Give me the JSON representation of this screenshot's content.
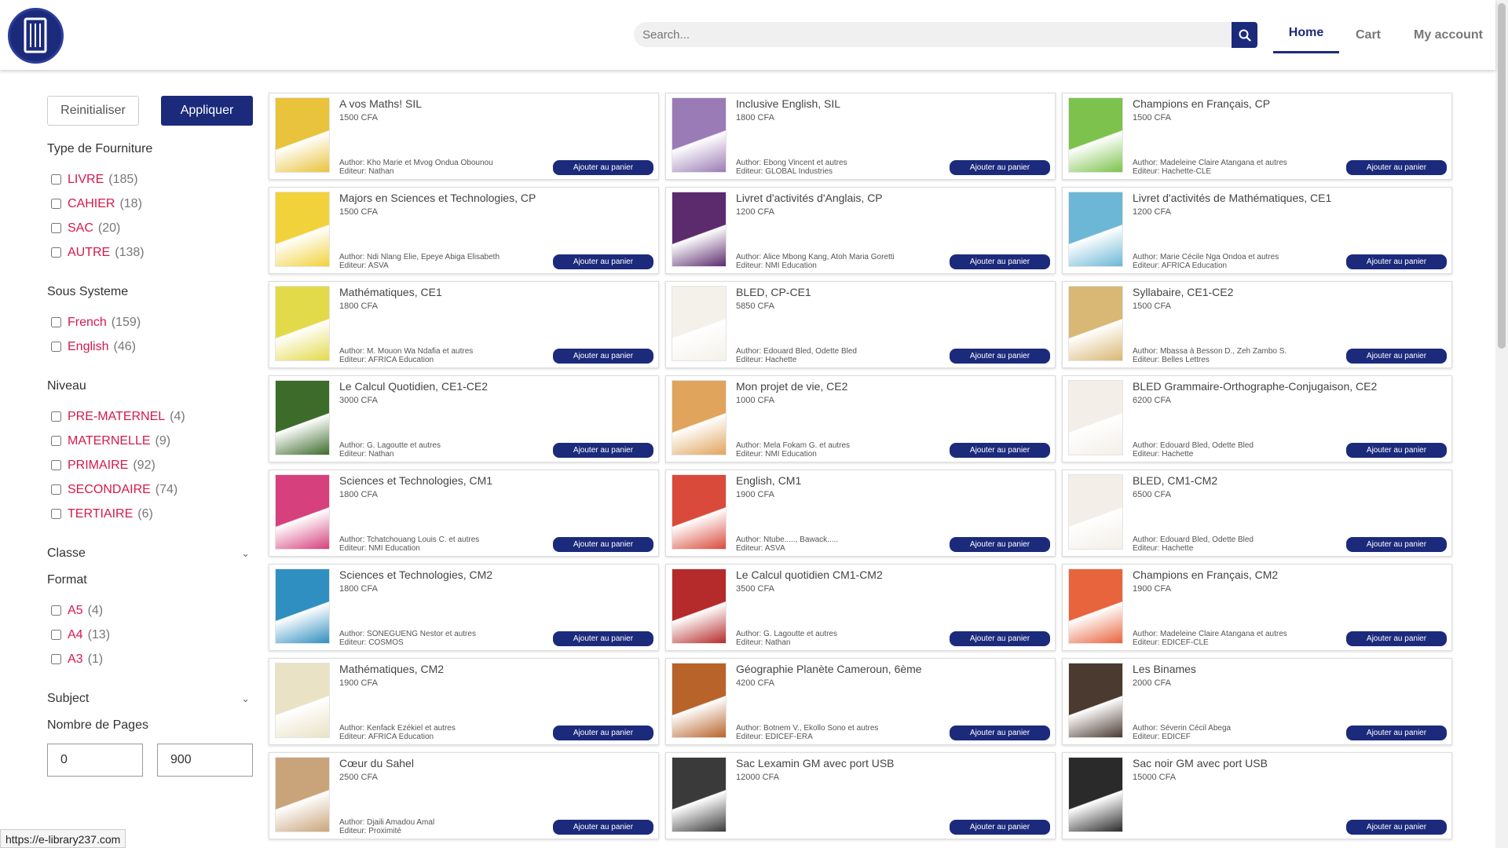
{
  "header": {
    "search_placeholder": "Search...",
    "nav": [
      {
        "label": "Home",
        "active": true
      },
      {
        "label": "Cart",
        "active": false
      },
      {
        "label": "My account",
        "active": false
      }
    ],
    "brand_color": "#1c2a7c"
  },
  "sidebar": {
    "reset_label": "Reinitialiser",
    "apply_label": "Appliquer",
    "type": {
      "title": "Type de Fourniture",
      "items": [
        {
          "label": "LIVRE",
          "count": "(185)"
        },
        {
          "label": "CAHIER",
          "count": "(18)"
        },
        {
          "label": "SAC",
          "count": "(20)"
        },
        {
          "label": "AUTRE",
          "count": "(138)"
        }
      ]
    },
    "sous_systeme": {
      "title": "Sous Systeme",
      "items": [
        {
          "label": "French",
          "count": "(159)"
        },
        {
          "label": "English",
          "count": "(46)"
        }
      ]
    },
    "niveau": {
      "title": "Niveau",
      "items": [
        {
          "label": "PRE-MATERNEL",
          "count": "(4)"
        },
        {
          "label": "MATERNELLE",
          "count": "(9)"
        },
        {
          "label": "PRIMAIRE",
          "count": "(92)"
        },
        {
          "label": "SECONDAIRE",
          "count": "(74)"
        },
        {
          "label": "TERTIAIRE",
          "count": "(6)"
        }
      ]
    },
    "classe_title": "Classe",
    "format": {
      "title": "Format",
      "items": [
        {
          "label": "A5",
          "count": "(4)"
        },
        {
          "label": "A4",
          "count": "(13)"
        },
        {
          "label": "A3",
          "count": "(1)"
        }
      ]
    },
    "subject_title": "Subject",
    "pages": {
      "title": "Nombre de Pages",
      "min": "0",
      "max": "900"
    }
  },
  "add_label": "Ajouter au panier",
  "products": [
    {
      "title": "A vos Maths! SIL",
      "price": "1500 CFA",
      "author": "Author: Kho Marie et Mvog Ondua Obounou",
      "editor": "Editeur: Nathan",
      "cover": "#e9c33b"
    },
    {
      "title": "Inclusive English, SIL",
      "price": "1800 CFA",
      "author": "Author: Ebong Vincent et autres",
      "editor": "Editeur: GLOBAL Industries",
      "cover": "#9a7bb5"
    },
    {
      "title": "Champions en Français, CP",
      "price": "1500 CFA",
      "author": "Author: Madeleine Claire Atangana et autres",
      "editor": "Editeur: Hachette-CLE",
      "cover": "#7cc24c"
    },
    {
      "title": "Majors en Sciences et Technologies, CP",
      "price": "1500 CFA",
      "author": "Author: Ndi Nlang Elie, Epeye Abiga Elisabeth",
      "editor": "Editeur: ASVA",
      "cover": "#f2d23a"
    },
    {
      "title": "Livret d'activités d'Anglais, CP",
      "price": "1200 CFA",
      "author": "Author: Alice Mbong Kang, Atoh Maria Goretti",
      "editor": "Editeur: NMI Education",
      "cover": "#5b2b6e"
    },
    {
      "title": "Livret d'activités de Mathématiques, CE1",
      "price": "1200 CFA",
      "author": "Author: Marie Cécile Nga Ondoa et autres",
      "editor": "Editeur: AFRICA Education",
      "cover": "#6cb7d6"
    },
    {
      "title": "Mathématiques, CE1",
      "price": "1800 CFA",
      "author": "Author: M. Mouon Wa Ndafia et autres",
      "editor": "Editeur: AFRICA Education",
      "cover": "#e3da4a"
    },
    {
      "title": "BLED, CP-CE1",
      "price": "5850 CFA",
      "author": "Author: Edouard Bled, Odette Bled",
      "editor": "Editeur: Hachette",
      "cover": "#f4f1ea"
    },
    {
      "title": "Syllabaire, CE1-CE2",
      "price": "1500 CFA",
      "author": "Author: Mbassa à Besson D., Zeh Zambo S.",
      "editor": "Editeur: Belles Lettres",
      "cover": "#d9b774"
    },
    {
      "title": "Le Calcul Quotidien, CE1-CE2",
      "price": "3000 CFA",
      "author": "Author: G. Lagoutte et autres",
      "editor": "Editeur: Nathan",
      "cover": "#3d6b2a"
    },
    {
      "title": "Mon projet de vie, CE2",
      "price": "1000 CFA",
      "author": "Author: Mela Fokam G. et autres",
      "editor": "Editeur: NMI Education",
      "cover": "#e0a45c"
    },
    {
      "title": "BLED Grammaire-Orthographe-Conjugaison, CE2",
      "price": "6200 CFA",
      "author": "Author: Edouard Bled, Odette Bled",
      "editor": "Editeur: Hachette",
      "cover": "#f3efe8"
    },
    {
      "title": "Sciences et Technologies, CM1",
      "price": "1800 CFA",
      "author": "Author: Tchatchouang Louis C. et autres",
      "editor": "Editeur: NMI Education",
      "cover": "#d6407c"
    },
    {
      "title": "English, CM1",
      "price": "1900 CFA",
      "author": "Author: Ntube....., Bawack.....",
      "editor": "Editeur: ASVA",
      "cover": "#d94a3a"
    },
    {
      "title": "BLED, CM1-CM2",
      "price": "6500 CFA",
      "author": "Author: Edouard Bled, Odette Bled",
      "editor": "Editeur: Hachette",
      "cover": "#f3efe8"
    },
    {
      "title": "Sciences et Technologies, CM2",
      "price": "1800 CFA",
      "author": "Author: SONEGUENG Nestor et autres",
      "editor": "Editeur: COSMOS",
      "cover": "#2f8fc0"
    },
    {
      "title": "Le Calcul quotidien CM1-CM2",
      "price": "3500 CFA",
      "author": "Author: G. Lagoutte et autres",
      "editor": "Editeur: Nathan",
      "cover": "#b52a2a"
    },
    {
      "title": "Champions en Français, CM2",
      "price": "1900 CFA",
      "author": "Author: Madeleine Claire Atangana et autres",
      "editor": "Editeur: EDICEF-CLE",
      "cover": "#e8643c"
    },
    {
      "title": "Mathématiques, CM2",
      "price": "1900 CFA",
      "author": "Author: Kenfack Ezékiel et autres",
      "editor": "Editeur: AFRICA Education",
      "cover": "#e9e2c5"
    },
    {
      "title": "Géographie Planète Cameroun, 6ème",
      "price": "4200 CFA",
      "author": "Author: Botnem V., Ekollo Sono et autres",
      "editor": "Editeur: EDICEF-ERA",
      "cover": "#b8632a"
    },
    {
      "title": "Les Binames",
      "price": "2000 CFA",
      "author": "Author: Séverin Cécil Abega",
      "editor": "Editeur: EDICEF",
      "cover": "#4a3a30"
    },
    {
      "title": "Cœur du Sahel",
      "price": "2500 CFA",
      "author": "Author: Djaili Amadou Amal",
      "editor": "Editeur: Proximité",
      "cover": "#c9a47a"
    },
    {
      "title": "Sac Lexamin GM avec port USB",
      "price": "12000 CFA",
      "author": "",
      "editor": "",
      "cover": "#3a3a3a"
    },
    {
      "title": "Sac noir GM avec port USB",
      "price": "15000 CFA",
      "author": "",
      "editor": "",
      "cover": "#2a2a2a"
    }
  ],
  "status_url": "https://e-library237.com"
}
